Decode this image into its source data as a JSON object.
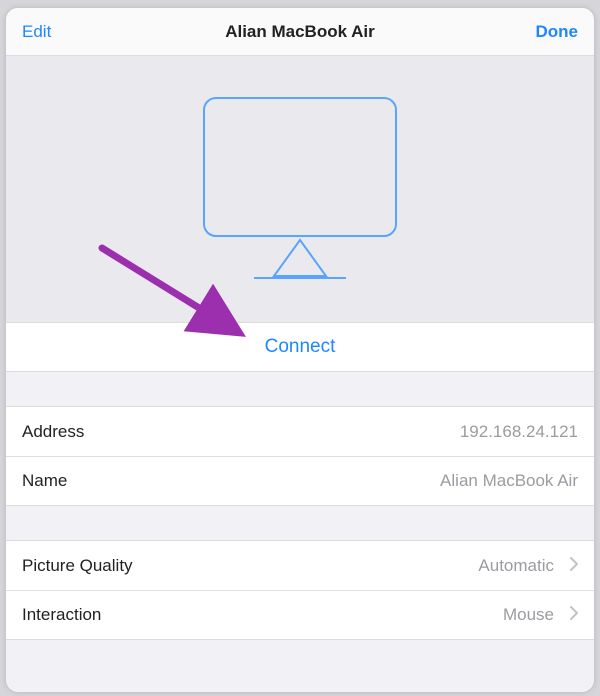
{
  "nav": {
    "edit": "Edit",
    "title": "Alian MacBook Air",
    "done": "Done"
  },
  "connect": {
    "label": "Connect"
  },
  "details": {
    "address": {
      "label": "Address",
      "value": "192.168.24.121"
    },
    "name": {
      "label": "Name",
      "value": "Alian MacBook Air"
    }
  },
  "settings": {
    "picture_quality": {
      "label": "Picture Quality",
      "value": "Automatic"
    },
    "interaction": {
      "label": "Interaction",
      "value": "Mouse"
    }
  },
  "annotation": {
    "arrow_color": "#9b2fae"
  }
}
